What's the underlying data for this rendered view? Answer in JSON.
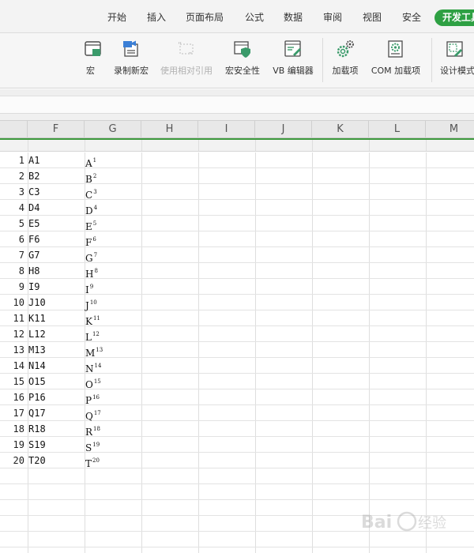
{
  "menu": {
    "items": [
      "开始",
      "插入",
      "页面布局",
      "公式",
      "数据",
      "审阅",
      "视图",
      "安全"
    ],
    "active": "开发工具"
  },
  "ribbon": {
    "buttons": [
      {
        "label": "宏",
        "icon": "macro-icon",
        "enabled": true
      },
      {
        "label": "录制新宏",
        "icon": "record-macro-icon",
        "enabled": true
      },
      {
        "label": "使用相对引用",
        "icon": "relative-reference-icon",
        "enabled": false
      },
      {
        "label": "宏安全性",
        "icon": "macro-security-icon",
        "enabled": true
      },
      {
        "label": "VB 编辑器",
        "icon": "vb-editor-icon",
        "enabled": true
      },
      {
        "label": "加载项",
        "icon": "addins-gear-icon",
        "enabled": true
      },
      {
        "label": "COM 加载项",
        "icon": "com-addins-icon",
        "enabled": true
      },
      {
        "label": "设计模式",
        "icon": "design-mode-icon",
        "enabled": true
      }
    ]
  },
  "columns": [
    "F",
    "G",
    "H",
    "I",
    "J",
    "K",
    "L",
    "M"
  ],
  "rows": [
    {
      "num": "1",
      "f": "A1",
      "g": "A",
      "sup": "1"
    },
    {
      "num": "2",
      "f": "B2",
      "g": "B",
      "sup": "2"
    },
    {
      "num": "3",
      "f": "C3",
      "g": "C",
      "sup": "3"
    },
    {
      "num": "4",
      "f": "D4",
      "g": "D",
      "sup": "4"
    },
    {
      "num": "5",
      "f": "E5",
      "g": "E",
      "sup": "5"
    },
    {
      "num": "6",
      "f": "F6",
      "g": "F",
      "sup": "6"
    },
    {
      "num": "7",
      "f": "G7",
      "g": "G",
      "sup": "7"
    },
    {
      "num": "8",
      "f": "H8",
      "g": "H",
      "sup": "8"
    },
    {
      "num": "9",
      "f": "I9",
      "g": "I",
      "sup": "9"
    },
    {
      "num": "10",
      "f": "J10",
      "g": "J",
      "sup": "10"
    },
    {
      "num": "11",
      "f": "K11",
      "g": "K",
      "sup": "11"
    },
    {
      "num": "12",
      "f": "L12",
      "g": "L",
      "sup": "12"
    },
    {
      "num": "13",
      "f": "M13",
      "g": "M",
      "sup": "13"
    },
    {
      "num": "14",
      "f": "N14",
      "g": "N",
      "sup": "14"
    },
    {
      "num": "15",
      "f": "O15",
      "g": "O",
      "sup": "15"
    },
    {
      "num": "16",
      "f": "P16",
      "g": "P",
      "sup": "16"
    },
    {
      "num": "17",
      "f": "Q17",
      "g": "Q",
      "sup": "17"
    },
    {
      "num": "18",
      "f": "R18",
      "g": "R",
      "sup": "18"
    },
    {
      "num": "19",
      "f": "S19",
      "g": "S",
      "sup": "19"
    },
    {
      "num": "20",
      "f": "T20",
      "g": "T",
      "sup": "20"
    }
  ],
  "colors": {
    "accent": "#2ea043",
    "header_line": "#3d9a3d"
  }
}
